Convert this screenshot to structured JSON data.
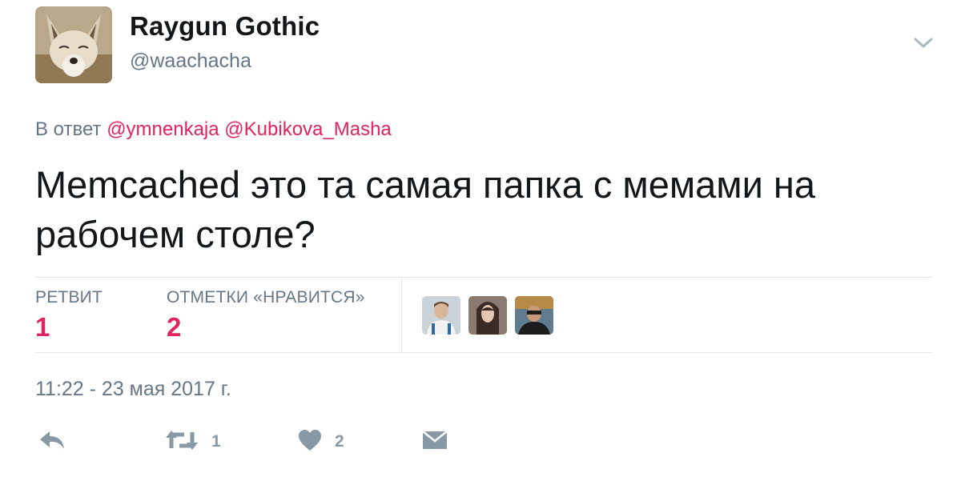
{
  "user": {
    "display_name": "Raygun Gothic",
    "handle": "@waachacha"
  },
  "reply": {
    "prefix": "В ответ",
    "mentions": [
      "@ymnenkaja",
      "@Kubikova_Masha"
    ]
  },
  "tweet": {
    "text": "Memcached это та самая папка с мемами на рабочем столе?"
  },
  "stats": {
    "retweets_label": "РЕТВИТ",
    "retweets_value": "1",
    "likes_label": "ОТМЕТКИ «НРАВИТСЯ»",
    "likes_value": "2"
  },
  "timestamp": "11:22 - 23 мая 2017 г.",
  "actions": {
    "retweet_count": "1",
    "like_count": "2"
  },
  "colors": {
    "accent": "#e0245e",
    "muted": "#657786",
    "icon": "#8899a6",
    "divider": "#e1e8ed"
  },
  "icons": [
    "chevron-down-icon",
    "reply-icon",
    "retweet-icon",
    "heart-icon",
    "mail-icon"
  ]
}
